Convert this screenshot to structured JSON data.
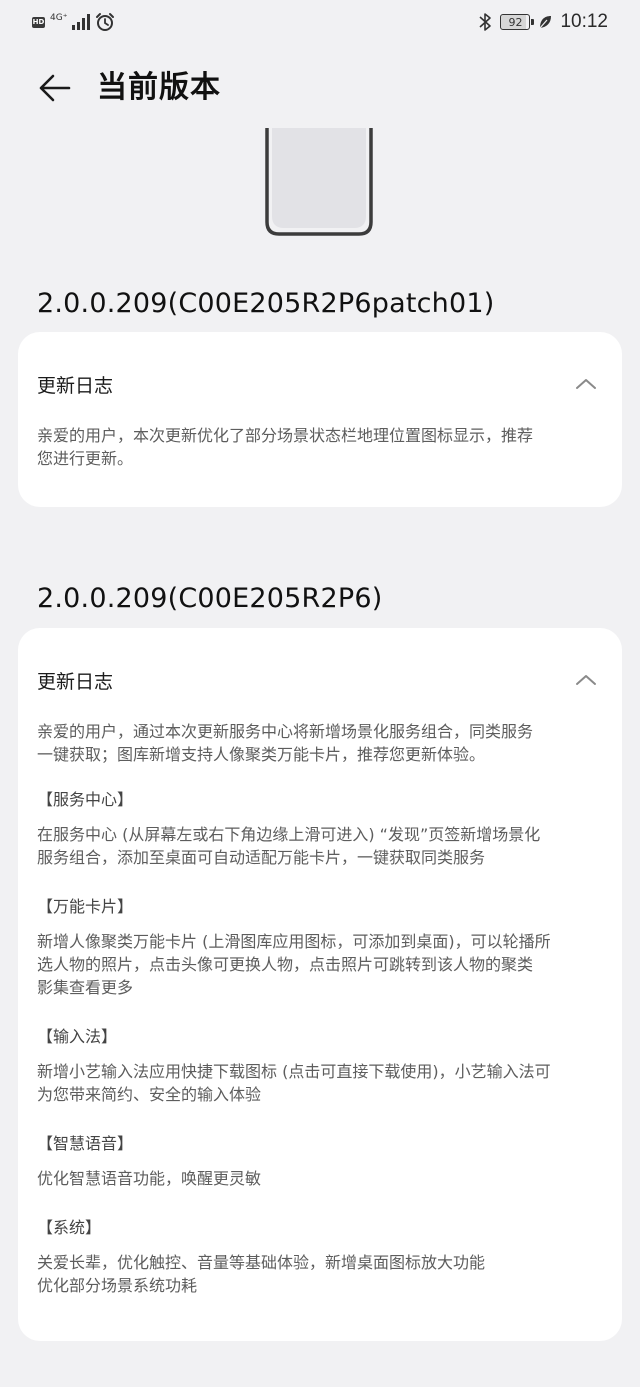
{
  "status_bar": {
    "hd": "HD",
    "network": "4G⁺",
    "battery": "92",
    "time": "10:12"
  },
  "header": {
    "title": "当前版本"
  },
  "versions": [
    {
      "version": "2.0.0.209(C00E205R2P6patch01)",
      "log_title": "更新日志",
      "paragraphs": [
        "亲爱的用户，本次更新优化了部分场景状态栏地理位置图标显示，推荐",
        "您进行更新。"
      ]
    },
    {
      "version": "2.0.0.209(C00E205R2P6)",
      "log_title": "更新日志",
      "intro": [
        "亲爱的用户，通过本次更新服务中心将新增场景化服务组合，同类服务",
        "一键获取；图库新增支持人像聚类万能卡片，推荐您更新体验。"
      ],
      "sections": [
        {
          "title": "【服务中心】",
          "lines": [
            "在服务中心 (从屏幕左或右下角边缘上滑可进入) “发现”页签新增场景化",
            "服务组合，添加至桌面可自动适配万能卡片，一键获取同类服务"
          ]
        },
        {
          "title": "【万能卡片】",
          "lines": [
            "新增人像聚类万能卡片 (上滑图库应用图标，可添加到桌面)，可以轮播所",
            "选人物的照片，点击头像可更换人物，点击照片可跳转到该人物的聚类",
            "影集查看更多"
          ]
        },
        {
          "title": "【输入法】",
          "lines": [
            "新增小艺输入法应用快捷下载图标 (点击可直接下载使用)，小艺输入法可",
            "为您带来简约、安全的输入体验"
          ]
        },
        {
          "title": "【智慧语音】",
          "lines": [
            "优化智慧语音功能，唤醒更灵敏"
          ]
        },
        {
          "title": "【系统】",
          "lines": [
            "关爱长辈，优化触控、音量等基础体验，新增桌面图标放大功能",
            "优化部分场景系统功耗"
          ]
        }
      ]
    }
  ]
}
